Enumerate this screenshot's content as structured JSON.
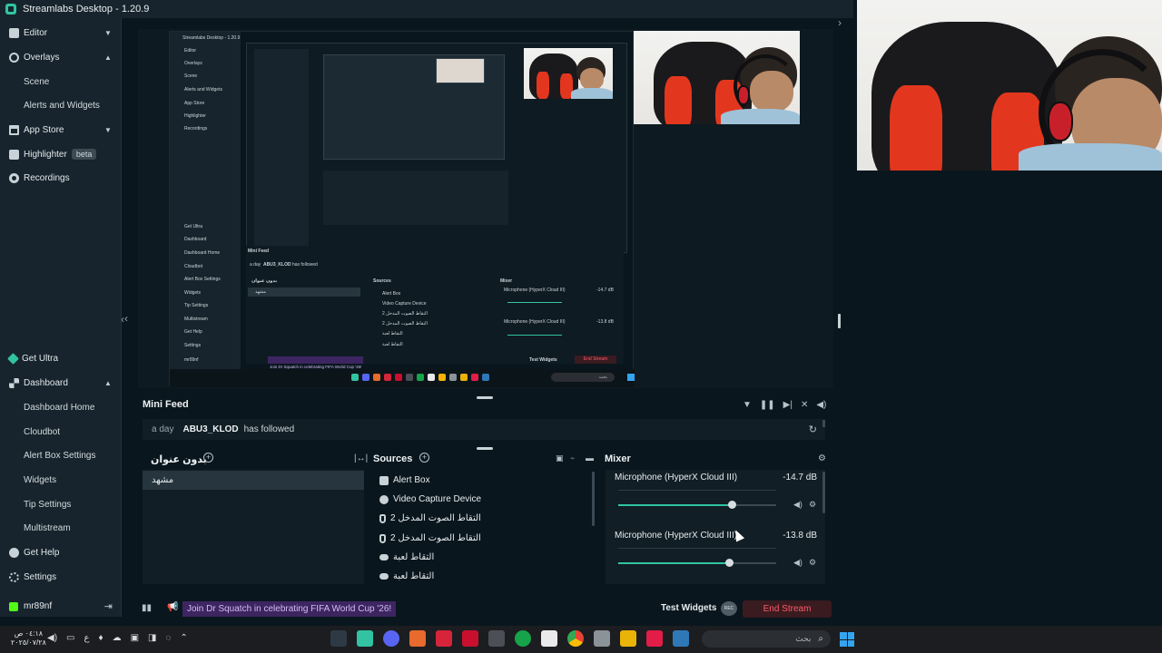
{
  "app": {
    "title": "Streamlabs Desktop - 1.20.9"
  },
  "sidebar": {
    "items": [
      {
        "label": "Editor",
        "icon": "editor-icon",
        "chevron": "down"
      },
      {
        "label": "Overlays",
        "icon": "overlays-icon",
        "chevron": "up"
      },
      {
        "label": "Scene",
        "sub": true
      },
      {
        "label": "Alerts and Widgets",
        "sub": true
      },
      {
        "label": "App Store",
        "icon": "app-store-icon",
        "chevron": "down"
      },
      {
        "label": "Highlighter",
        "icon": "highlighter-icon",
        "badge": "beta"
      },
      {
        "label": "Recordings",
        "icon": "recordings-icon"
      }
    ],
    "bottom": [
      {
        "label": "Get Ultra",
        "icon": "ultra-icon"
      },
      {
        "label": "Dashboard",
        "icon": "dashboard-icon",
        "chevron": "up"
      },
      {
        "label": "Dashboard Home",
        "sub": true
      },
      {
        "label": "Cloudbot",
        "sub": true
      },
      {
        "label": "Alert Box Settings",
        "sub": true
      },
      {
        "label": "Widgets",
        "sub": true
      },
      {
        "label": "Tip Settings",
        "sub": true
      },
      {
        "label": "Multistream",
        "sub": true
      },
      {
        "label": "Get Help",
        "icon": "help-icon"
      },
      {
        "label": "Settings",
        "icon": "settings-icon"
      }
    ],
    "user": {
      "name": "mr89nf"
    }
  },
  "minifeed": {
    "title": "Mini Feed",
    "event": {
      "time": "a day",
      "user": "ABU3_KLOD",
      "action": "has followed"
    }
  },
  "scenes": {
    "title": "بدون عنوان",
    "items": [
      "مشهد"
    ]
  },
  "sources": {
    "title": "Sources",
    "items": [
      {
        "label": "Alert Box",
        "icon": "alert-box-icon"
      },
      {
        "label": "Video Capture Device",
        "icon": "camera-icon"
      },
      {
        "label": "التقاط الصوت المدخل 2",
        "icon": "mic-icon"
      },
      {
        "label": "التقاط الصوت المدخل 2",
        "icon": "mic-icon"
      },
      {
        "label": "التقاط لعبة",
        "icon": "gamepad-icon"
      },
      {
        "label": "التقاط لعبة",
        "icon": "gamepad-icon"
      }
    ]
  },
  "mixer": {
    "title": "Mixer",
    "channels": [
      {
        "name": "Microphone (HyperX Cloud III)",
        "db": "-14.7 dB",
        "level": 0.72
      },
      {
        "name": "Microphone (HyperX Cloud III)",
        "db": "-13.8 dB",
        "level": 0.7
      }
    ]
  },
  "footer": {
    "promo": "Join Dr Squatch in celebrating FIFA World Cup '26!",
    "test_widgets": "Test Widgets",
    "rec_label": "REC",
    "end_stream": "End Stream"
  },
  "nested": {
    "title": "Streamlabs Desktop - 1.20.9",
    "sidebar": [
      "Editor",
      "Overlays",
      "Scene",
      "Alerts and Widgets",
      "App Store",
      "Highlighter",
      "Recordings",
      "Get Ultra",
      "Dashboard",
      "Dashboard Home",
      "Cloudbot",
      "Alert Box Settings",
      "Widgets",
      "Tip Settings",
      "Multistream",
      "Get Help",
      "Settings",
      "mr89nf"
    ],
    "minifeed": "Mini Feed",
    "event_time": "a day",
    "event_user": "ABU3_KLOD",
    "event_action": "has followed",
    "scenes": "بدون عنوان",
    "scene_item": "مشهد",
    "sources": "Sources",
    "source_items": [
      "Alert Box",
      "Video Capture Device",
      "التقاط الصوت المدخل 2",
      "التقاط الصوت المدخل 2",
      "التقاط لعبة",
      "التقاط لعبة"
    ],
    "mixer": "Mixer",
    "mix1": "Microphone (HyperX Cloud III)",
    "mix1_db": "-14.7 dB",
    "mix2": "Microphone (HyperX Cloud III)",
    "mix2_db": "-13.8 dB",
    "promo": "Join Dr Squatch in celebrating FIFA World Cup '26!",
    "test_widgets": "Test Widgets",
    "end_stream": "End Stream",
    "search": "بحث"
  },
  "taskbar": {
    "time": "٠٤:١٨ ص",
    "date": "٢٠٢٥/٠٧/٢٨",
    "lang": "ع",
    "search_placeholder": "بحث"
  },
  "colors": {
    "accent": "#31c3a2",
    "end_stream": "#ff5a6a",
    "promo_bg": "#3c2560",
    "webcam_chair_red": "#e2371e"
  }
}
